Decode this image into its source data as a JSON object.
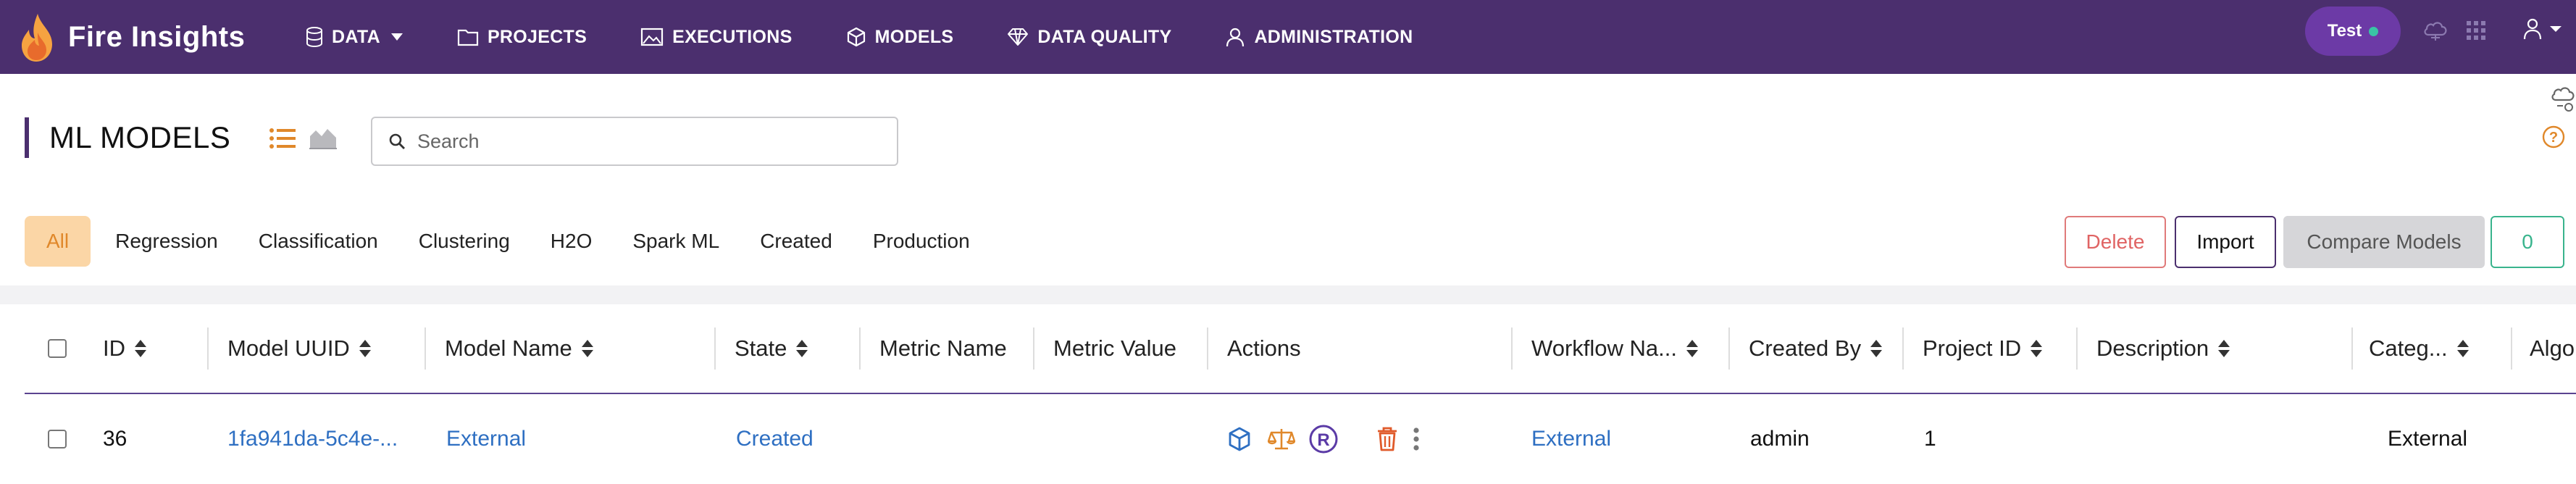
{
  "app": {
    "name": "Fire Insights",
    "nav": [
      {
        "label": "DATA",
        "icon": "database-icon"
      },
      {
        "label": "PROJECTS",
        "icon": "folder-icon"
      },
      {
        "label": "EXECUTIONS",
        "icon": "image-icon"
      },
      {
        "label": "MODELS",
        "icon": "cube-icon"
      },
      {
        "label": "DATA QUALITY",
        "icon": "diamond-icon"
      },
      {
        "label": "ADMINISTRATION",
        "icon": "user-icon"
      }
    ],
    "user_pill": "Test",
    "colors": {
      "topbar": "#4b2f6e",
      "pill": "#6c3aa6",
      "status_dot": "#39c4a5",
      "accent_orange": "#e0882a",
      "link": "#2e6fc2"
    }
  },
  "page": {
    "title": "ML MODELS",
    "search_placeholder": "Search",
    "filters": [
      "All",
      "Regression",
      "Classification",
      "Clustering",
      "H2O",
      "Spark ML",
      "Created",
      "Production"
    ],
    "active_filter": "All",
    "buttons": {
      "delete": "Delete",
      "import": "Import",
      "compare": "Compare Models",
      "count": "0"
    }
  },
  "table": {
    "columns": [
      "ID",
      "Model UUID",
      "Model Name",
      "State",
      "Metric Name",
      "Metric Value",
      "Actions",
      "Workflow Na...",
      "Created By",
      "Project ID",
      "Description",
      "Categ...",
      "Algo"
    ],
    "rows": [
      {
        "id": "36",
        "uuid": "1fa941da-5c4e-...",
        "model_name": "External",
        "state": "Created",
        "metric_name": "",
        "metric_value": "",
        "actions": [
          "cube-icon",
          "scale-icon",
          "registered-icon",
          "trash-icon",
          "more-vertical-icon"
        ],
        "workflow_name": "External",
        "created_by": "admin",
        "project_id": "1",
        "description": "",
        "category": "External"
      }
    ]
  }
}
